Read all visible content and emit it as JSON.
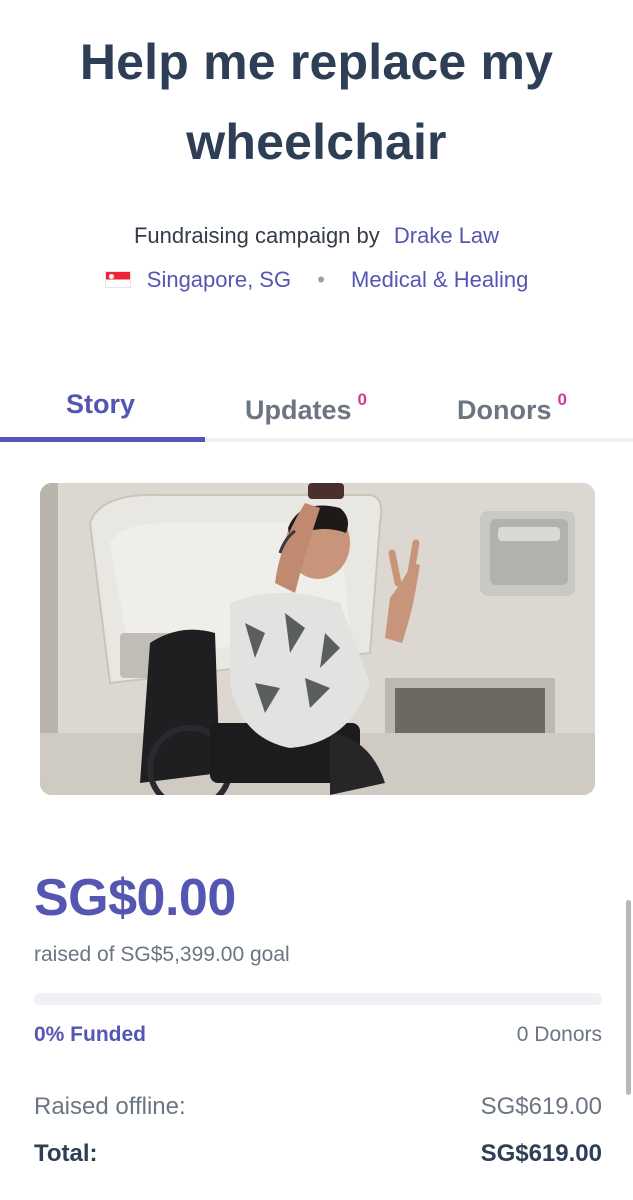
{
  "campaign": {
    "title": "Help me replace my wheelchair",
    "byline_prefix": "Fundraising campaign by",
    "author": "Drake Law",
    "location": "Singapore, SG",
    "separator": "•",
    "category": "Medical & Healing",
    "flag_icon": "singapore-flag-icon"
  },
  "tabs": [
    {
      "label": "Story",
      "count": null,
      "active": true
    },
    {
      "label": "Updates",
      "count": "0",
      "active": false
    },
    {
      "label": "Donors",
      "count": "0",
      "active": false
    }
  ],
  "photo": {
    "description_icon": "campaign-photo"
  },
  "funding": {
    "raised": "SG$0.00",
    "goal_text": "raised of SG$5,399.00 goal",
    "progress_fraction": 0,
    "funded_text": "0% Funded",
    "donors_text": "0 Donors"
  },
  "summary": {
    "offline_label": "Raised offline:",
    "offline_value": "SG$619.00",
    "total_label": "Total:",
    "total_value": "SG$619.00"
  },
  "colors": {
    "accent": "#5556b2",
    "title": "#2d3e55",
    "muted": "#6c7582",
    "badge": "#d43a8e"
  }
}
